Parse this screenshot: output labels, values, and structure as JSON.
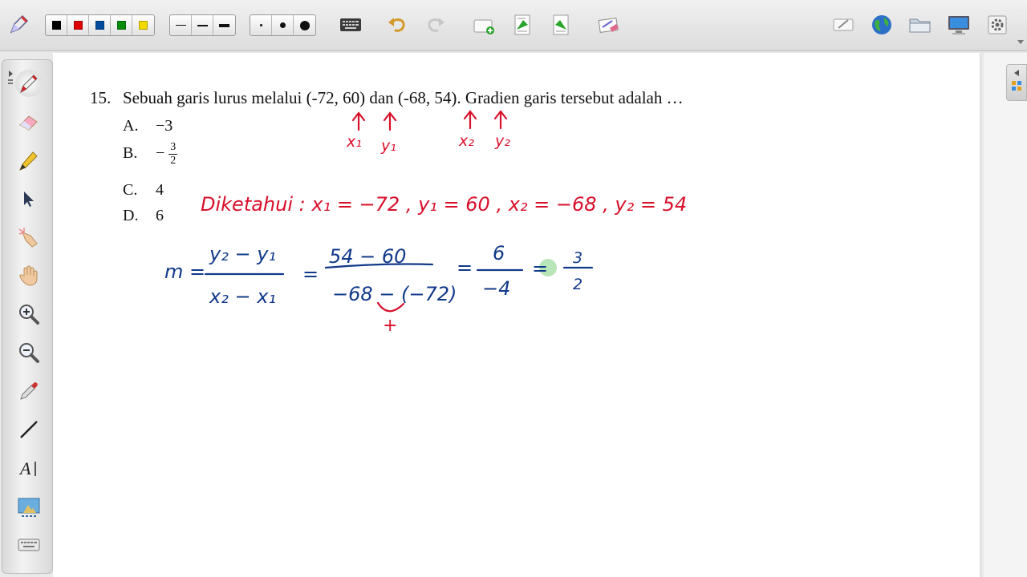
{
  "toolbar": {
    "pen_colors": [
      "#000000",
      "#dd0000",
      "#004b9b",
      "#0a8c0a",
      "#f0d800"
    ],
    "line_widths": [
      "thin",
      "medium",
      "thick"
    ],
    "point_sizes": [
      "small",
      "medium",
      "large"
    ],
    "icons": [
      "pen-tool-icon",
      "keyboard-icon",
      "undo-icon",
      "redo-icon",
      "add-page-icon",
      "previous-page-icon",
      "next-page-icon",
      "clear-page-icon",
      "rename-icon",
      "web-globe-icon",
      "folder-icon",
      "desktop-icon",
      "settings-icon"
    ]
  },
  "tools": [
    "pen-icon",
    "eraser-icon",
    "highlighter-icon",
    "pointer-icon",
    "laser-pointer-icon",
    "hand-icon",
    "zoom-in-icon",
    "zoom-out-icon",
    "color-picker-icon",
    "line-icon",
    "text-tool-icon",
    "capture-icon",
    "virtual-keyboard-icon"
  ],
  "question": {
    "number": "15.",
    "text": "Sebuah garis lurus melalui (-72, 60) dan (-68, 54). Gradien garis tersebut adalah …",
    "options": [
      {
        "label": "A.",
        "value": "−3"
      },
      {
        "label": "B.",
        "sign": "−",
        "num": "3",
        "den": "2"
      },
      {
        "label": "C.",
        "value": "4"
      },
      {
        "label": "D.",
        "value": "6"
      }
    ]
  },
  "annotations": {
    "ink_red": "#d8102a",
    "ink_blue": "#123a8a",
    "ink_highlight": "#7ed17e",
    "arrow_labels": [
      "x₁",
      "y₁",
      "x₂",
      "y₂"
    ],
    "diketahui": "Diketahui : x₁ = −72 , y₁ = 60 , x₂ = −68 , y₂ = 54",
    "gradient": {
      "m": "m =",
      "f1_num": "y₂ − y₁",
      "f1_den": "x₂ − x₁",
      "eq2": "=",
      "f2_num": "54 − 60",
      "f2_den": "−68 − (−72)",
      "eq3": "=",
      "f3_num": "6",
      "f3_den": "−4",
      "eq4": "=",
      "f4_num": "3",
      "f4_den": "2",
      "plus": "+"
    }
  }
}
